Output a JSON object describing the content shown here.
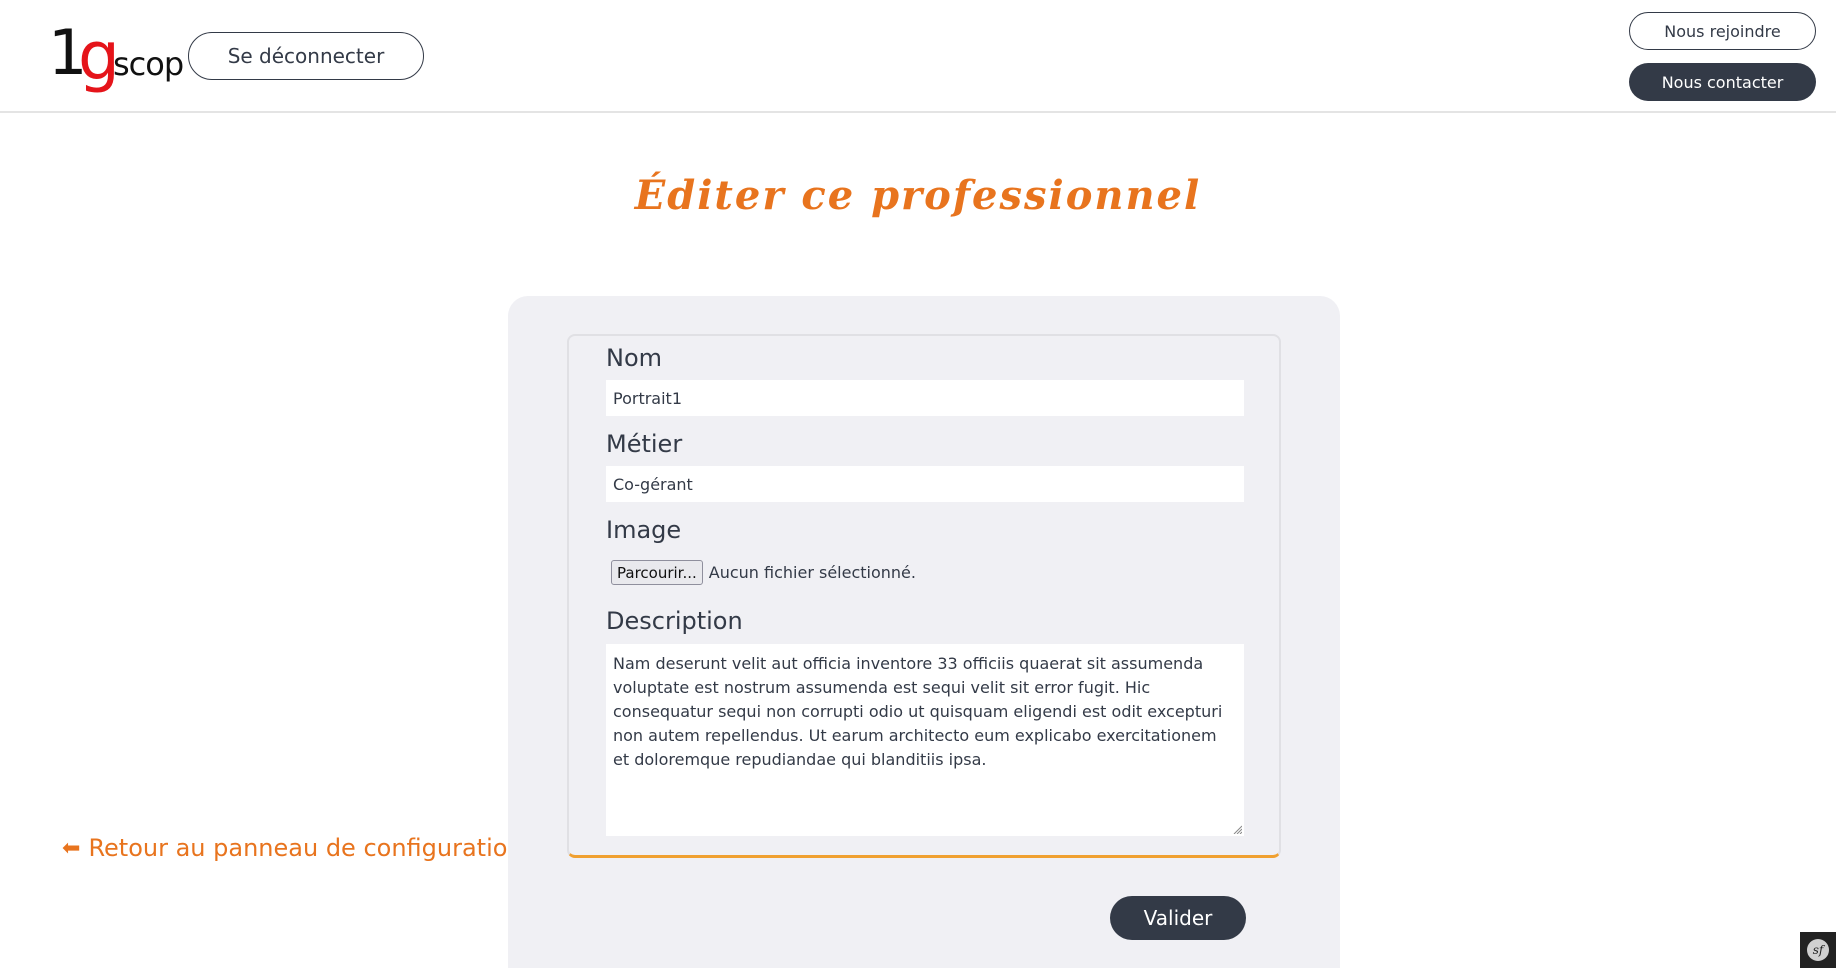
{
  "header": {
    "logo": {
      "one": "1",
      "g": "g",
      "scop": "scop"
    },
    "logout_label": "Se déconnecter",
    "join_label": "Nous rejoindre",
    "contact_label": "Nous contacter"
  },
  "page": {
    "title": "Éditer ce professionnel"
  },
  "form": {
    "name_label": "Nom",
    "name_value": "Portrait1",
    "job_label": "Métier",
    "job_value": "Co-gérant",
    "image_label": "Image",
    "file_button": "Parcourir...",
    "file_status": "Aucun fichier sélectionné.",
    "description_label": "Description",
    "description_value": "Nam deserunt velit aut officia inventore 33 officiis quaerat sit assumenda voluptate est nostrum assumenda est sequi velit sit error fugit. Hic consequatur sequi non corrupti odio ut quisquam eligendi est odit excepturi non autem repellendus. Ut earum architecto eum explicabo exercitationem et doloremque repudiandae qui blanditiis ipsa.",
    "submit_label": "Valider"
  },
  "back_link": {
    "arrow": "⬅",
    "label": "Retour au panneau de configuration"
  },
  "colors": {
    "accent": "#e8741e",
    "dark": "#333a47",
    "logo_red": "#e5141a",
    "card_bg": "#f0f0f4"
  },
  "icons": {
    "symfony_toolbar": "symfony-icon"
  }
}
